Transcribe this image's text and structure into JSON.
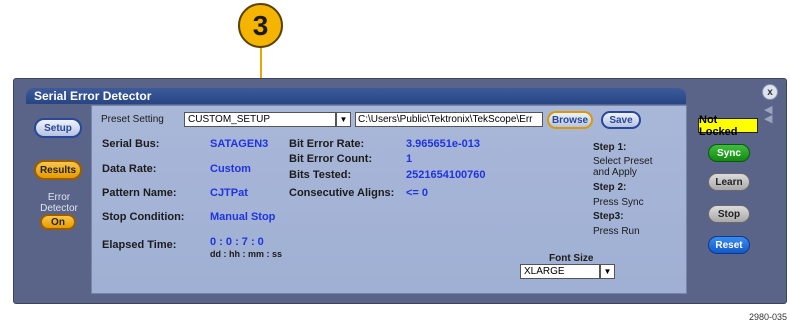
{
  "callout": {
    "number": "3"
  },
  "window": {
    "title": "Serial Error Detector",
    "close_glyph": "x"
  },
  "sidebar": {
    "setup_label": "Setup",
    "results_label": "Results",
    "error_detector_label": "Error Detector",
    "on_label": "On"
  },
  "preset": {
    "label": "Preset Setting",
    "value": "CUSTOM_SETUP",
    "path": "C:\\Users\\Public\\Tektronix\\TekScope\\Err",
    "browse_label": "Browse",
    "save_label": "Save"
  },
  "fields": {
    "serial_bus_label": "Serial Bus:",
    "serial_bus_value": "SATAGEN3",
    "data_rate_label": "Data Rate:",
    "data_rate_value": "Custom",
    "pattern_name_label": "Pattern Name:",
    "pattern_name_value": "CJTPat",
    "stop_condition_label": "Stop Condition:",
    "stop_condition_value": "Manual Stop",
    "elapsed_time_label": "Elapsed Time:",
    "elapsed_time_value": "0 : 0 : 7 : 0",
    "elapsed_time_format": "dd : hh : mm : ss"
  },
  "stats": {
    "bit_error_rate_label": "Bit Error Rate:",
    "bit_error_rate_value": "3.965651e-013",
    "bit_error_count_label": "Bit Error Count:",
    "bit_error_count_value": "1",
    "bits_tested_label": "Bits Tested:",
    "bits_tested_value": "2521654100760",
    "consecutive_aligns_label": "Consecutive Aligns:",
    "consecutive_aligns_value": "<= 0"
  },
  "steps": {
    "step1_title": "Step 1:",
    "step1_line1": "Select Preset",
    "step1_line2": "and Apply",
    "step2_title": "Step 2:",
    "step2_text": "Press Sync",
    "step3_title": "Step3:",
    "step3_text": "Press Run"
  },
  "font": {
    "label": "Font Size",
    "value": "XLARGE"
  },
  "right_panel": {
    "status": "Not Locked",
    "sync_label": "Sync",
    "learn_label": "Learn",
    "stop_label": "Stop",
    "reset_label": "Reset"
  },
  "colors": {
    "value_text": "#1f33e0",
    "not_locked_bg": "#ffff00",
    "sync_green": "#138a13",
    "reset_blue": "#1458c8",
    "accent_orange": "#e79a00"
  },
  "figure_id": "2980-035"
}
